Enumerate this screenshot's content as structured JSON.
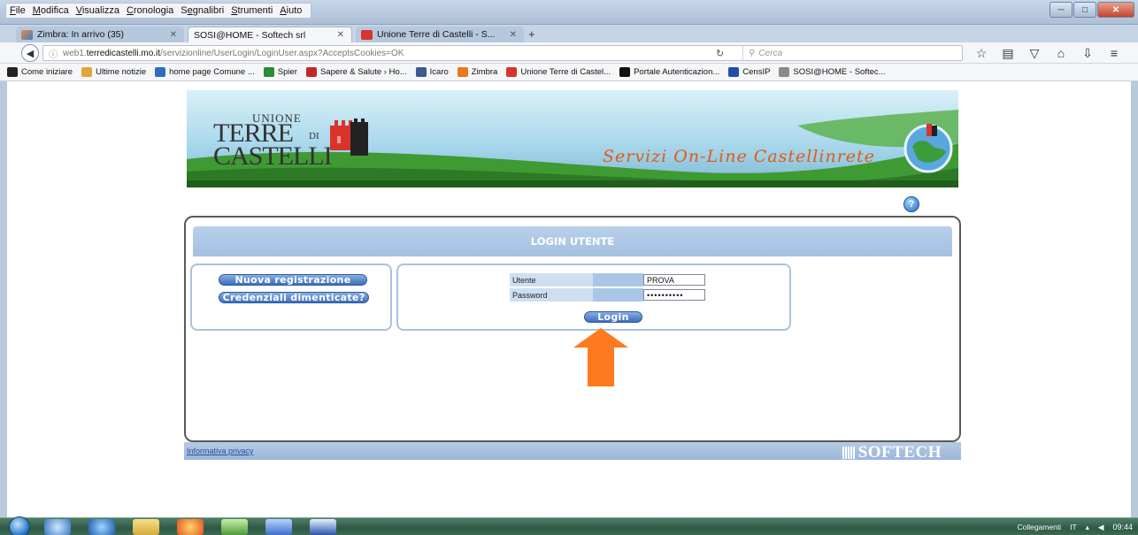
{
  "menubar": {
    "items": [
      {
        "key": "F",
        "rest": "ile"
      },
      {
        "key": "M",
        "rest": "odifica"
      },
      {
        "key": "V",
        "rest": "isualizza"
      },
      {
        "key": "C",
        "rest": "ronologia"
      },
      {
        "pre": "S",
        "key": "e",
        "rest": "gnalibri"
      },
      {
        "key": "S",
        "rest": "trumenti"
      },
      {
        "key": "A",
        "rest": "iuto"
      }
    ]
  },
  "tabs": [
    {
      "label": "Zimbra: In arrivo (35)"
    },
    {
      "label": "SOSI@HOME - Softech srl"
    },
    {
      "label": "Unione Terre di Castelli - S..."
    }
  ],
  "navbar": {
    "url_prefix": "web1.",
    "url_domain": "terredicastelli.mo.it",
    "url_path": "/servizionline/UserLogin/LoginUser.aspx?AcceptsCookies=OK",
    "search_placeholder": "Cerca"
  },
  "bookmarks": [
    {
      "label": "Come iniziare",
      "color": "#222222"
    },
    {
      "label": "Ultime notizie",
      "color": "#e2a43b"
    },
    {
      "label": "home page Comune ...",
      "color": "#2f6fb8"
    },
    {
      "label": "Spier",
      "color": "#2c8a3a"
    },
    {
      "label": "Sapere & Salute › Ho...",
      "color": "#c4262e"
    },
    {
      "label": "Icaro",
      "color": "#3c5a8c"
    },
    {
      "label": "Zimbra",
      "color": "#e57a1f"
    },
    {
      "label": "Unione Terre di Castel...",
      "color": "#d9342b"
    },
    {
      "label": "Portale Autenticazion...",
      "color": "#111111"
    },
    {
      "label": "CensIP",
      "color": "#1f4fa8"
    },
    {
      "label": "SOSI@HOME - Softec...",
      "color": "#8a8a8a"
    }
  ],
  "banner": {
    "logo_unione": "UNIONE",
    "logo_terre": "TERRE",
    "logo_di": "DI",
    "logo_castelli": "CASTELLI",
    "slogan": "Servizi On-Line Castellinrete"
  },
  "login": {
    "header": "LOGIN UTENTE",
    "register_label": "Nuova registrazione",
    "forgot_label": "Credenziali dimenticate?",
    "user_label": "Utente",
    "user_value": "PROVA",
    "password_label": "Password",
    "password_value": "••••••••••",
    "login_label": "Login"
  },
  "footer": {
    "privacy_link": "Informativa privacy",
    "brand": "SOFTECH"
  },
  "taskbar": {
    "tray_label": "Collegamenti",
    "lang": "IT",
    "time": "09:44"
  },
  "colors": {
    "accent_orange": "#ff7a1e",
    "header_blue": "#a3c0e0",
    "button_blue": "#3a6fbd"
  }
}
